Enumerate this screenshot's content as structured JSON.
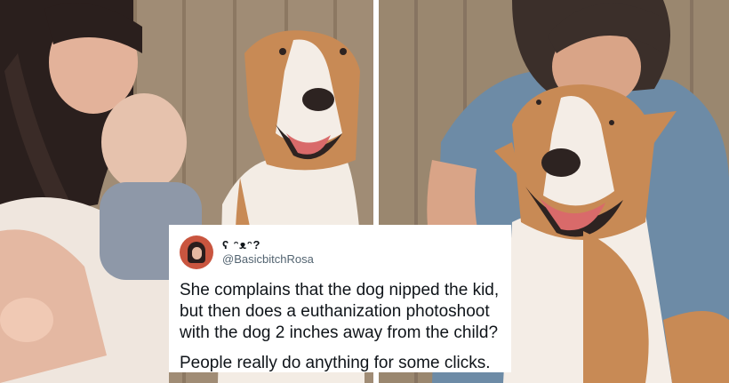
{
  "photos": [
    {
      "subject": "Woman holding a baby next to a bull terrier in front of a wooden fence"
    },
    {
      "subject": "Man hugging a smiling bull terrier in front of a wooden fence"
    }
  ],
  "tweet": {
    "display_name": "ʕ ᵔᴥᵔ?",
    "handle": "@BasicbitchRosa",
    "text": "She complains that the dog nipped the kid, but then does a euthanization photoshoot with the dog 2 inches away from the child?",
    "followup": "People really do anything for some clicks."
  },
  "colors": {
    "fence": "#9e8a73",
    "dog_fur": "#c88a55",
    "shirt": "#6d8ba6",
    "divider": "#ffffff"
  }
}
